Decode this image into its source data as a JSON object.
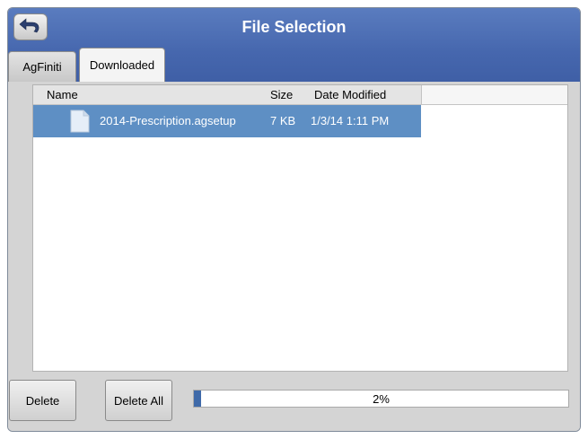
{
  "window": {
    "title": "File Selection"
  },
  "tabs": [
    {
      "label": "AgFiniti",
      "selected": false
    },
    {
      "label": "Downloaded",
      "selected": true
    }
  ],
  "file_list": {
    "columns": [
      "Name",
      "Size",
      "Date Modified"
    ],
    "rows": [
      {
        "name": "2014-Prescription.agsetup",
        "size": "7 KB",
        "date_modified": "1/3/14 1:11 PM",
        "icon": "document-icon",
        "selected": true
      }
    ]
  },
  "buttons": {
    "delete": "Delete",
    "delete_all": "Delete All"
  },
  "progress": {
    "value": 0.02,
    "label": "2%"
  },
  "colors": {
    "title_bar": "#4667ae",
    "selected_row": "#5e8fc4",
    "progress_fill": "#3f6aa9",
    "panel_bg": "#d4d4d4"
  }
}
